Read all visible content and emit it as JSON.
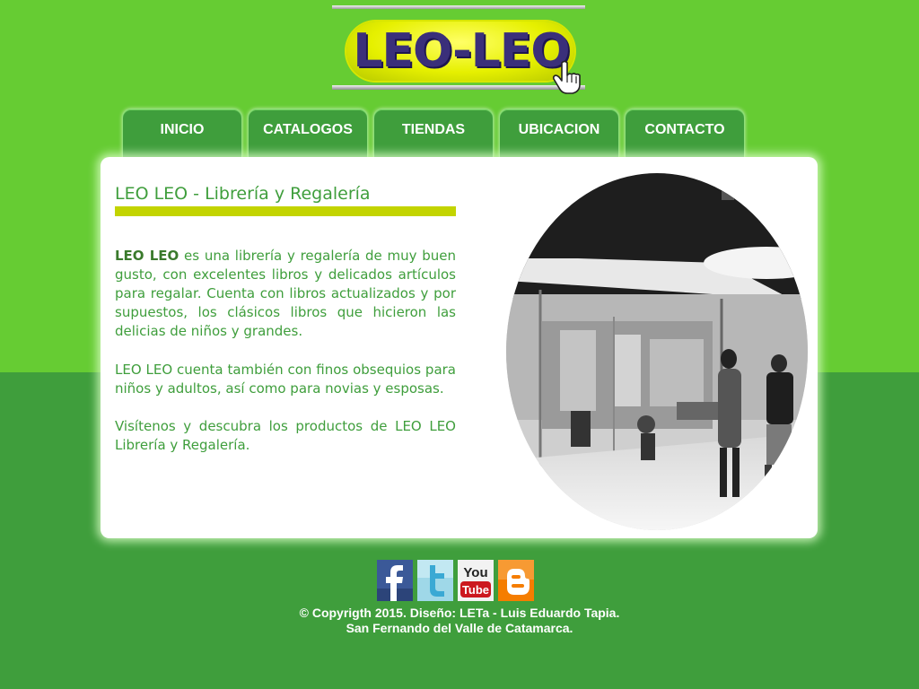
{
  "logo": {
    "text": "LEO-LEO",
    "icon": "pointing-hand-icon"
  },
  "nav": {
    "items": [
      {
        "label": "INICIO"
      },
      {
        "label": "CATALOGOS"
      },
      {
        "label": "TIENDAS"
      },
      {
        "label": "UBICACION"
      },
      {
        "label": "CONTACTO"
      }
    ]
  },
  "main": {
    "heading": "LEO LEO - Librería y Regalería",
    "p1_bold": "LEO LEO",
    "p1_rest": " es una librería y regalería de muy buen gusto, con excelentes libros y delicados artículos para regalar. Cuenta con libros actualizados y por supuestos, los clásicos libros que hicieron las delicias de niños y grandes.",
    "p2": "LEO LEO cuenta también con finos obsequios para niños y adultos, así como para novias y esposas.",
    "p3": "Visítenos y descubra los productos de LEO LEO Librería y Regalería.",
    "photo": "office-interior-photo"
  },
  "footer": {
    "social": [
      {
        "name": "facebook",
        "icon": "facebook-icon"
      },
      {
        "name": "twitter",
        "icon": "twitter-icon"
      },
      {
        "name": "youtube",
        "icon": "youtube-icon",
        "text_top": "You",
        "text_bottom": "Tube"
      },
      {
        "name": "blogger",
        "icon": "blogger-icon"
      }
    ],
    "copyright_line1": "© Copyrigth 2015. Diseño: LETa - Luis Eduardo Tapia.",
    "copyright_line2": "San Fernando del Valle de Catamarca."
  },
  "colors": {
    "bg_top": "#66cc33",
    "bg_bottom": "#3f9e3c",
    "nav_tab": "#3f9e3c",
    "text_green": "#3f9e3c",
    "heading_bar": "#c3d400",
    "logo_yellow": "#e6f000",
    "logo_text": "#3a2f7a"
  }
}
